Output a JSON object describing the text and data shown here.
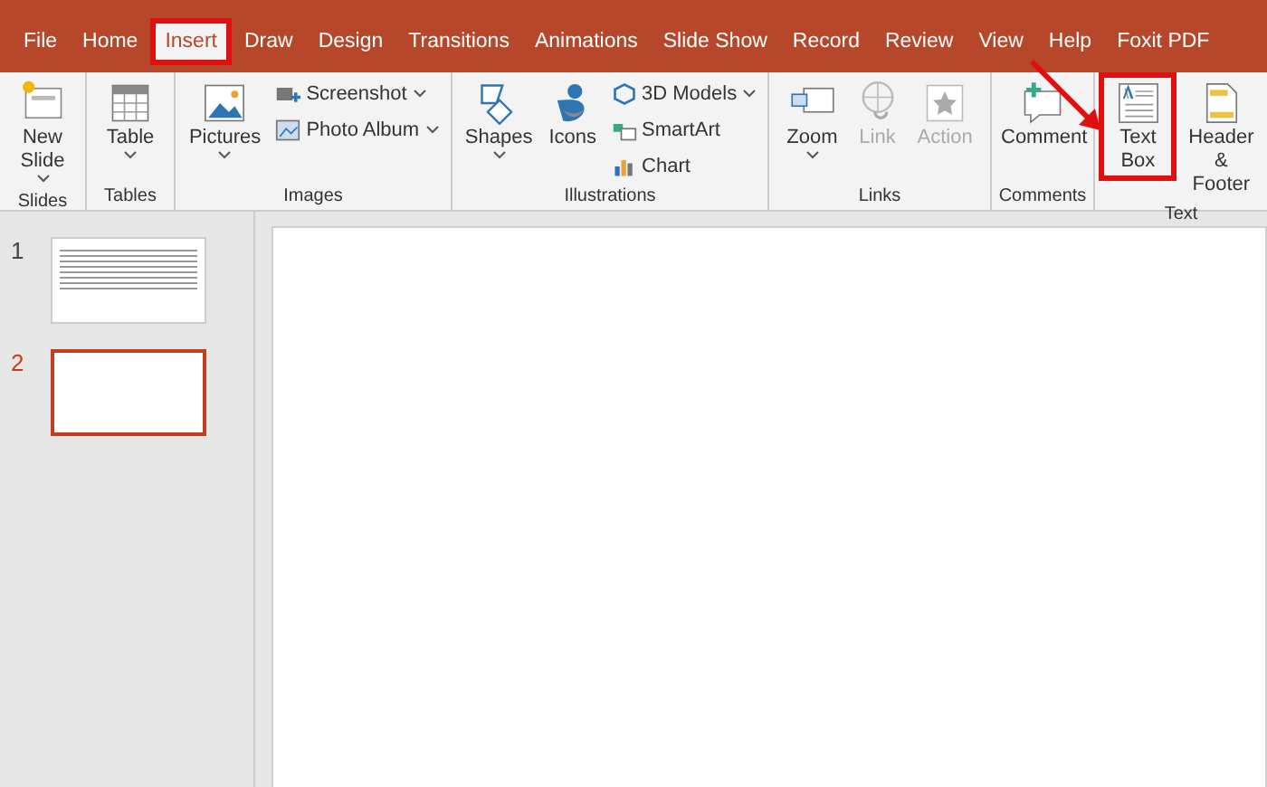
{
  "tabs": [
    {
      "label": "File",
      "selected": false,
      "highlighted": false
    },
    {
      "label": "Home",
      "selected": false,
      "highlighted": false
    },
    {
      "label": "Insert",
      "selected": true,
      "highlighted": true
    },
    {
      "label": "Draw",
      "selected": false,
      "highlighted": false
    },
    {
      "label": "Design",
      "selected": false,
      "highlighted": false
    },
    {
      "label": "Transitions",
      "selected": false,
      "highlighted": false
    },
    {
      "label": "Animations",
      "selected": false,
      "highlighted": false
    },
    {
      "label": "Slide Show",
      "selected": false,
      "highlighted": false
    },
    {
      "label": "Record",
      "selected": false,
      "highlighted": false
    },
    {
      "label": "Review",
      "selected": false,
      "highlighted": false
    },
    {
      "label": "View",
      "selected": false,
      "highlighted": false
    },
    {
      "label": "Help",
      "selected": false,
      "highlighted": false
    },
    {
      "label": "Foxit PDF",
      "selected": false,
      "highlighted": false
    }
  ],
  "ribbon_groups": [
    {
      "label": "Slides",
      "items": [
        {
          "kind": "large",
          "label": "New Slide",
          "dropdown": true,
          "disabled": false,
          "highlighted": false
        }
      ]
    },
    {
      "label": "Tables",
      "items": [
        {
          "kind": "large",
          "label": "Table",
          "dropdown": true,
          "disabled": false,
          "highlighted": false
        }
      ]
    },
    {
      "label": "Images",
      "items": [
        {
          "kind": "large",
          "label": "Pictures",
          "dropdown": true,
          "disabled": false,
          "highlighted": false
        },
        {
          "kind": "small",
          "label": "Screenshot",
          "dropdown": true,
          "disabled": false,
          "highlighted": false
        },
        {
          "kind": "small",
          "label": "Photo Album",
          "dropdown": true,
          "disabled": false,
          "highlighted": false
        }
      ]
    },
    {
      "label": "Illustrations",
      "items": [
        {
          "kind": "large",
          "label": "Shapes",
          "dropdown": true,
          "disabled": false,
          "highlighted": false
        },
        {
          "kind": "large",
          "label": "Icons",
          "dropdown": false,
          "disabled": false,
          "highlighted": false
        },
        {
          "kind": "small",
          "label": "3D Models",
          "dropdown": true,
          "disabled": false,
          "highlighted": false
        },
        {
          "kind": "small",
          "label": "SmartArt",
          "dropdown": false,
          "disabled": false,
          "highlighted": false
        },
        {
          "kind": "small",
          "label": "Chart",
          "dropdown": false,
          "disabled": false,
          "highlighted": false
        }
      ]
    },
    {
      "label": "Links",
      "items": [
        {
          "kind": "large",
          "label": "Zoom",
          "dropdown": true,
          "disabled": false,
          "highlighted": false
        },
        {
          "kind": "large",
          "label": "Link",
          "dropdown": false,
          "disabled": true,
          "highlighted": false
        },
        {
          "kind": "large",
          "label": "Action",
          "dropdown": false,
          "disabled": true,
          "highlighted": false
        }
      ]
    },
    {
      "label": "Comments",
      "items": [
        {
          "kind": "large",
          "label": "Comment",
          "dropdown": false,
          "disabled": false,
          "highlighted": false
        }
      ]
    },
    {
      "label": "Text",
      "items": [
        {
          "kind": "large",
          "label": "Text Box",
          "dropdown": false,
          "disabled": false,
          "highlighted": true
        },
        {
          "kind": "large",
          "label": "Header & Footer",
          "dropdown": false,
          "disabled": false,
          "highlighted": false
        }
      ]
    }
  ],
  "slides": [
    {
      "number": "1",
      "selected": false,
      "has_text": true
    },
    {
      "number": "2",
      "selected": true,
      "has_text": false
    }
  ]
}
